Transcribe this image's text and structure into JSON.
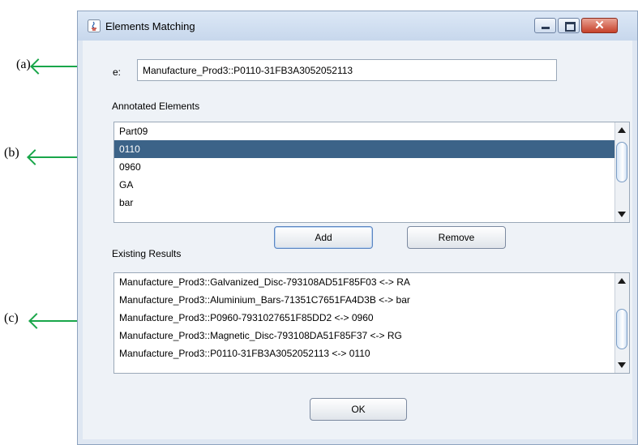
{
  "annotations": {
    "a": "(a)",
    "b": "(b)",
    "c": "(c)"
  },
  "window": {
    "title": "Elements Matching"
  },
  "element": {
    "label": "e:",
    "value": "Manufacture_Prod3::P0110-31FB3A3052052113"
  },
  "annotated": {
    "label": "Annotated Elements",
    "items": [
      "Part09",
      "0110",
      "0960",
      "GA",
      "bar"
    ],
    "selected_index": 1
  },
  "buttons": {
    "add": "Add",
    "remove": "Remove",
    "ok": "OK"
  },
  "existing": {
    "label": "Existing Results",
    "items": [
      "Manufacture_Prod3::Galvanized_Disc-793108AD51F85F03   <->   RA",
      "Manufacture_Prod3::Aluminium_Bars-71351C7651FA4D3B   <->   bar",
      "Manufacture_Prod3::P0960-7931027651F85DD2   <->   0960",
      "Manufacture_Prod3::Magnetic_Disc-793108DA51F85F37   <->   RG",
      "Manufacture_Prod3::P0110-31FB3A3052052113   <->   0110"
    ]
  },
  "colors": {
    "arrow": "#19a64a",
    "selection": "#3c6388"
  }
}
